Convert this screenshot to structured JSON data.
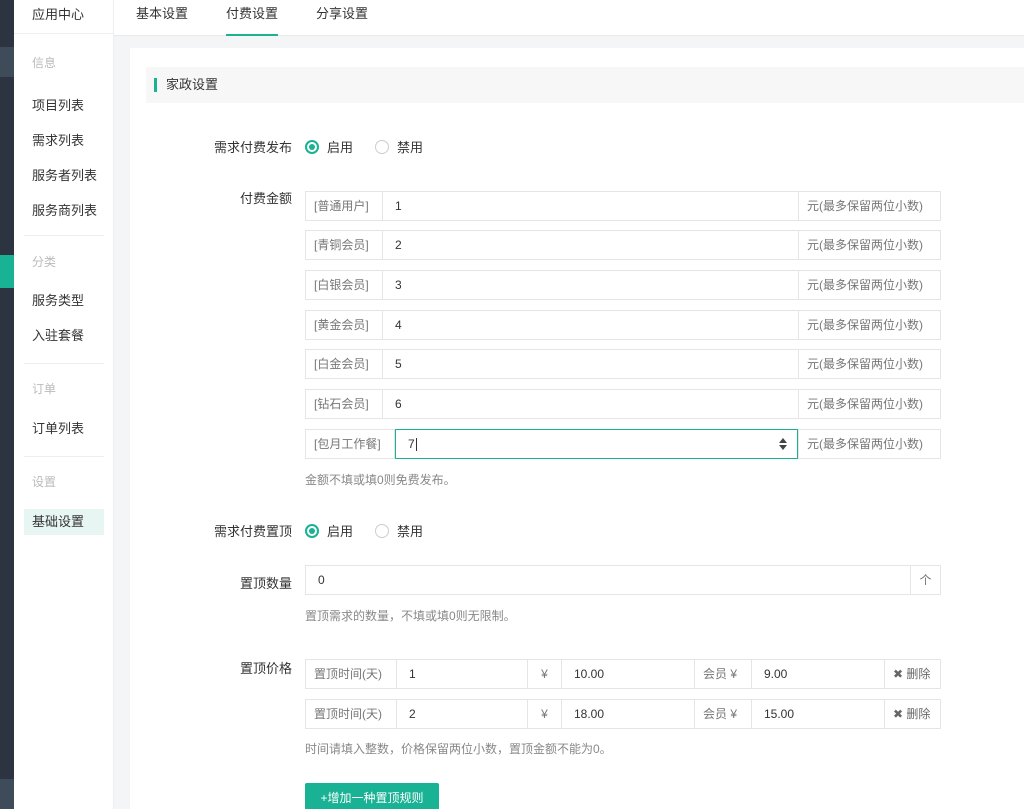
{
  "app_title": "应用中心",
  "sidebar": {
    "groups": [
      {
        "heading": "信息",
        "items": [
          "项目列表",
          "需求列表",
          "服务者列表",
          "服务商列表"
        ]
      },
      {
        "heading": "分类",
        "items": [
          "服务类型",
          "入驻套餐"
        ]
      },
      {
        "heading": "订单",
        "items": [
          "订单列表"
        ]
      },
      {
        "heading": "设置",
        "items": [
          "基础设置"
        ]
      }
    ]
  },
  "tabs": [
    "基本设置",
    "付费设置",
    "分享设置"
  ],
  "panel": {
    "title": "家政设置"
  },
  "publish": {
    "label": "需求付费发布",
    "opt_on": "启用",
    "opt_off": "禁用"
  },
  "fee": {
    "label": "付费金额",
    "suffix": "元(最多保留两位小数)",
    "rows": [
      {
        "level": "[普通用户]",
        "value": "1"
      },
      {
        "level": "[青铜会员]",
        "value": "2"
      },
      {
        "level": "[白银会员]",
        "value": "3"
      },
      {
        "level": "[黄金会员]",
        "value": "4"
      },
      {
        "level": "[白金会员]",
        "value": "5"
      },
      {
        "level": "[钻石会员]",
        "value": "6"
      },
      {
        "level": "[包月工作餐]",
        "value": "7"
      }
    ],
    "hint": "金额不填或填0则免费发布。"
  },
  "top": {
    "label": "需求付费置顶",
    "opt_on": "启用",
    "opt_off": "禁用"
  },
  "top_count": {
    "label": "置顶数量",
    "value": "0",
    "arrow": "个",
    "hint": "置顶需求的数量，不填或填0则无限制。"
  },
  "top_price": {
    "label": "置顶价格",
    "time_label": "置顶时间(天)",
    "yen": "¥",
    "member_label": "会员 ¥",
    "delete_label": "删除",
    "rows": [
      {
        "days": "1",
        "price": "10.00",
        "member_price": "9.00"
      },
      {
        "days": "2",
        "price": "18.00",
        "member_price": "15.00"
      }
    ],
    "hint": "时间请填入整数，价格保留两位小数，置顶金额不能为0。",
    "add_button": "+增加一种置顶规则"
  }
}
